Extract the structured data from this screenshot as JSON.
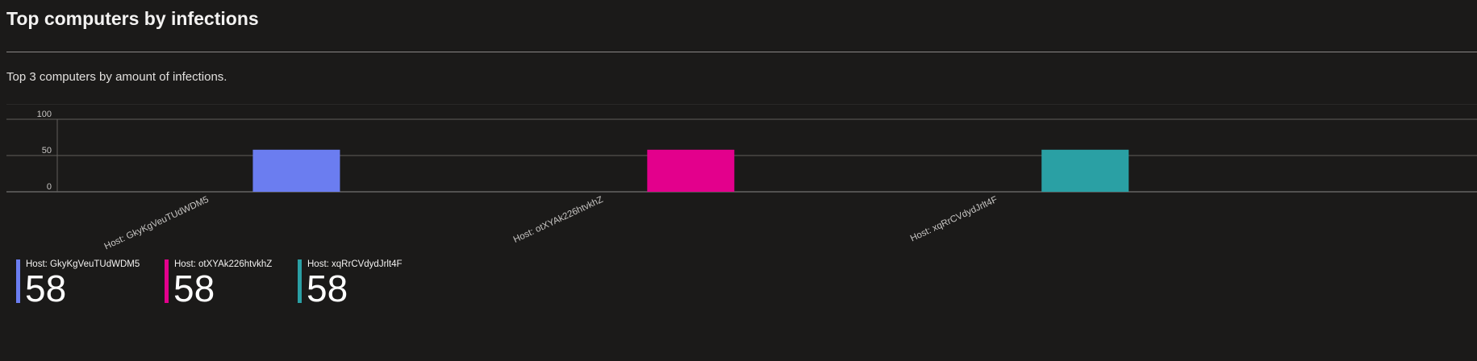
{
  "header": {
    "title": "Top computers by infections",
    "subtitle": "Top 3 computers by amount of infections."
  },
  "chart_data": {
    "type": "bar",
    "title": "Top computers by infections",
    "subtitle": "Top 3 computers by amount of infections.",
    "categories": [
      "Host: GkyKgVeuTUdWDM5",
      "Host: otXYAk226htvkhZ",
      "Host: xqRrCVdydJrlt4F"
    ],
    "values": [
      58,
      58,
      58
    ],
    "colors": [
      "#6b7df0",
      "#e3008c",
      "#2aa0a4"
    ],
    "yticks": [
      0,
      50,
      100
    ],
    "ylim": [
      0,
      100
    ],
    "grid": true,
    "legend_position": "bottom-left",
    "x_label_rotation": "diagonal"
  },
  "legend": {
    "items": [
      {
        "label": "Host: GkyKgVeuTUdWDM5",
        "value": "58",
        "color": "#6b7df0"
      },
      {
        "label": "Host: otXYAk226htvkhZ",
        "value": "58",
        "color": "#e3008c"
      },
      {
        "label": "Host: xqRrCVdydJrlt4F",
        "value": "58",
        "color": "#2aa0a4"
      }
    ]
  }
}
